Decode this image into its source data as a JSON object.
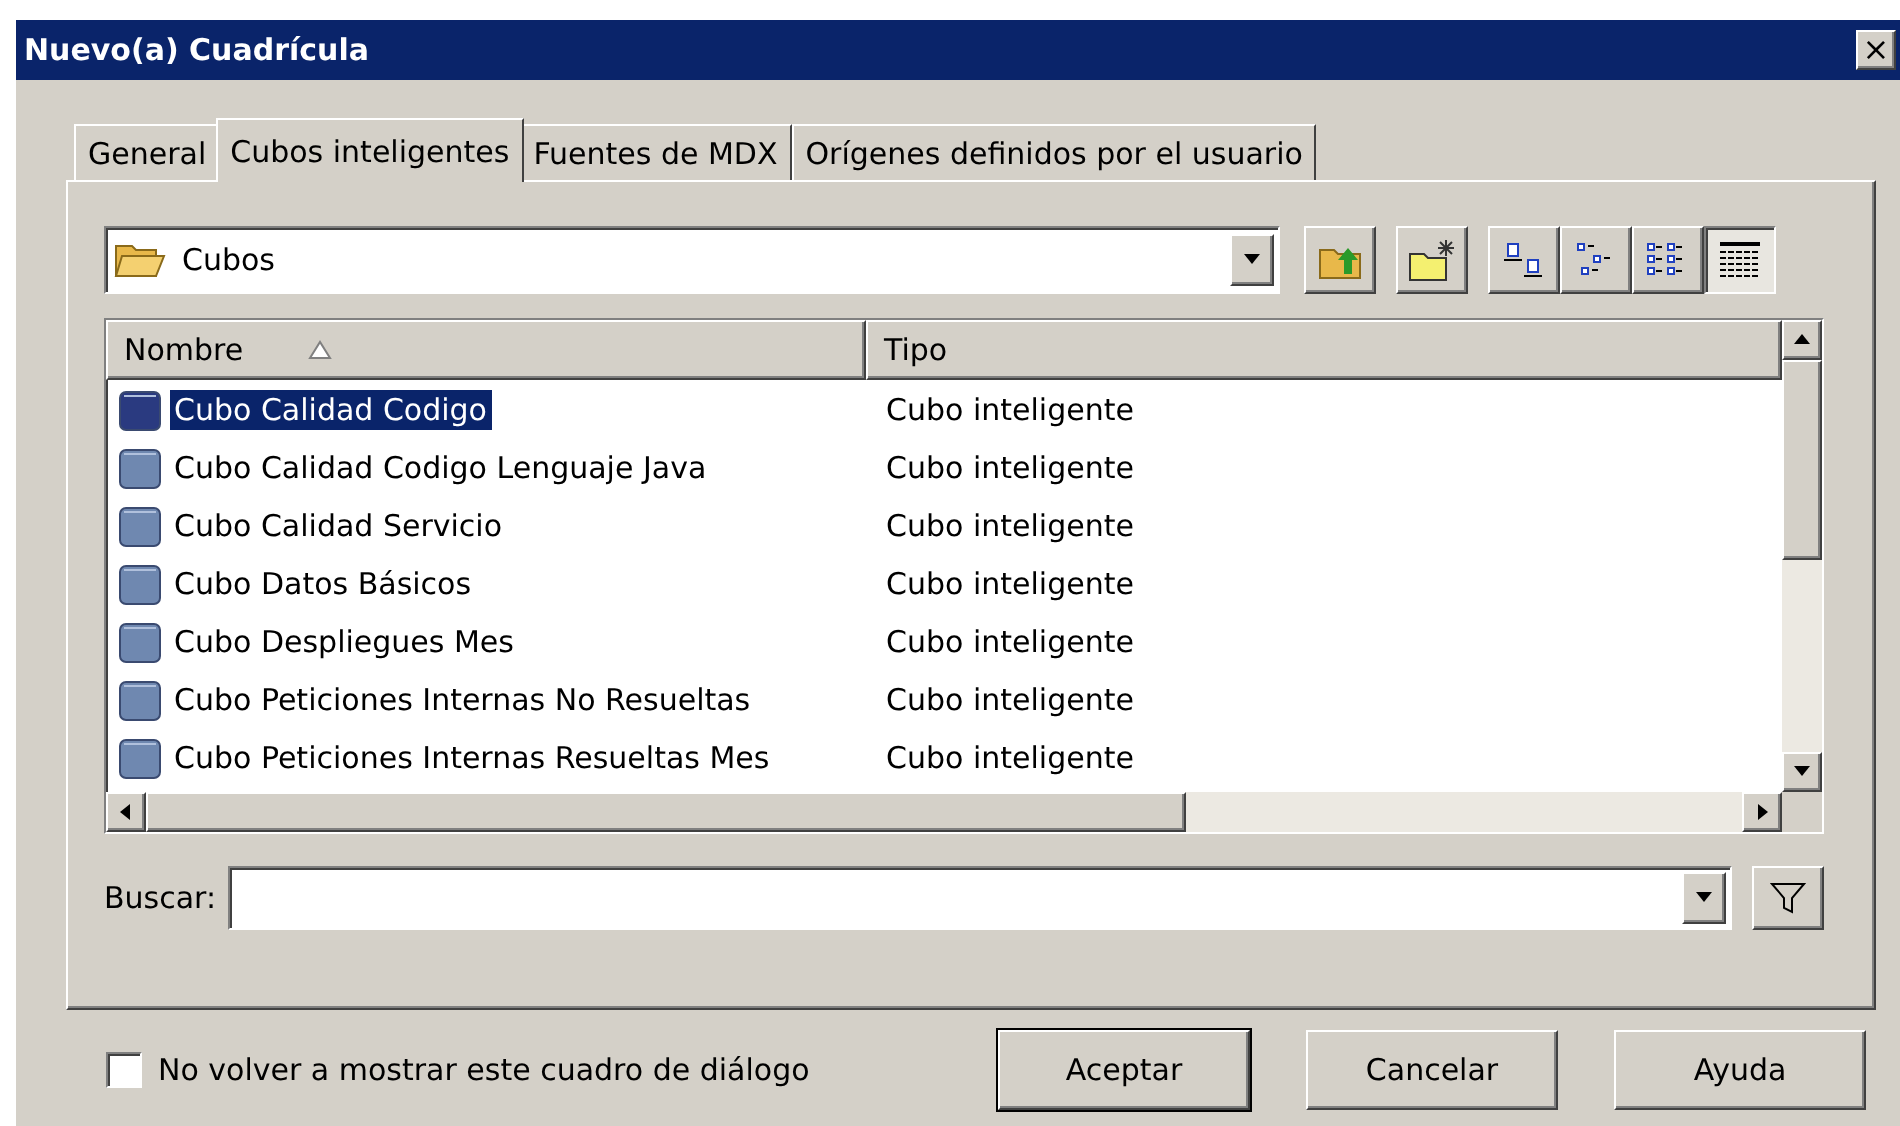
{
  "window": {
    "title": "Nuevo(a) Cuadrícula",
    "close": "×"
  },
  "tabs": [
    {
      "label": "General",
      "selected": false
    },
    {
      "label": "Cubos inteligentes",
      "selected": true
    },
    {
      "label": "Fuentes de MDX",
      "selected": false
    },
    {
      "label": "Orígenes definidos por el usuario",
      "selected": false
    }
  ],
  "location": {
    "value": "Cubos"
  },
  "toolbar": [
    {
      "kind": "up",
      "selected": false
    },
    {
      "kind": "newfolder",
      "selected": false
    },
    {
      "kind": "large",
      "selected": false
    },
    {
      "kind": "small",
      "selected": false
    },
    {
      "kind": "list",
      "selected": false
    },
    {
      "kind": "details",
      "selected": true
    }
  ],
  "table": {
    "columns": [
      "Nombre",
      "Tipo"
    ],
    "rows": [
      {
        "name": "Cubo Calidad Codigo",
        "type": "Cubo inteligente",
        "selected": true
      },
      {
        "name": "Cubo Calidad Codigo Lenguaje Java",
        "type": "Cubo inteligente",
        "selected": false
      },
      {
        "name": "Cubo Calidad Servicio",
        "type": "Cubo inteligente",
        "selected": false
      },
      {
        "name": "Cubo Datos Básicos",
        "type": "Cubo inteligente",
        "selected": false
      },
      {
        "name": "Cubo Despliegues Mes",
        "type": "Cubo inteligente",
        "selected": false
      },
      {
        "name": "Cubo Peticiones Internas No Resueltas",
        "type": "Cubo inteligente",
        "selected": false
      },
      {
        "name": "Cubo Peticiones Internas Resueltas Mes",
        "type": "Cubo inteligente",
        "selected": false
      }
    ]
  },
  "search": {
    "label": "Buscar:"
  },
  "dont_show": {
    "label": "No volver a mostrar este cuadro de diálogo",
    "checked": false
  },
  "buttons": [
    "Aceptar",
    "Cancelar",
    "Ayuda"
  ]
}
